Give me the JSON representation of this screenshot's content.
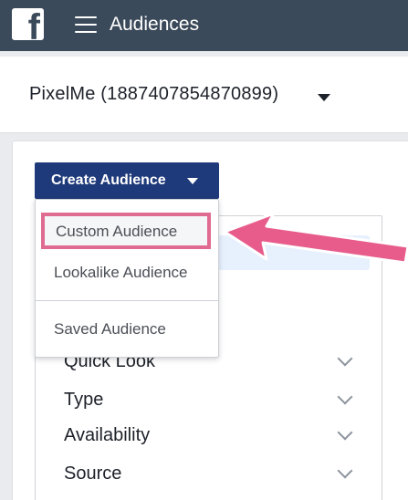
{
  "header": {
    "title": "Audiences",
    "logo_glyph": "f",
    "logo_icon": "facebook-logo-icon",
    "menu_icon": "hamburger-menu-icon",
    "background": "#3b4a5a"
  },
  "account": {
    "name": "PixelMe (1887407854870899)",
    "caret_icon": "caret-down-icon"
  },
  "create_button": {
    "label": "Create Audience",
    "caret_icon": "caret-down-icon",
    "color": "#1f3a7a"
  },
  "dropdown": {
    "items": [
      {
        "label": "Custom Audience",
        "highlighted": true
      },
      {
        "label": "Lookalike Audience"
      },
      {
        "label": "Saved Audience"
      }
    ]
  },
  "filters": {
    "items": [
      {
        "label": "Quick Look"
      },
      {
        "label": "Type"
      },
      {
        "label": "Availability"
      },
      {
        "label": "Source"
      }
    ],
    "chevron_icon": "chevron-down-icon"
  },
  "annotation": {
    "highlight_color": "#e06b91",
    "arrow_icon": "pointer-arrow-icon"
  }
}
